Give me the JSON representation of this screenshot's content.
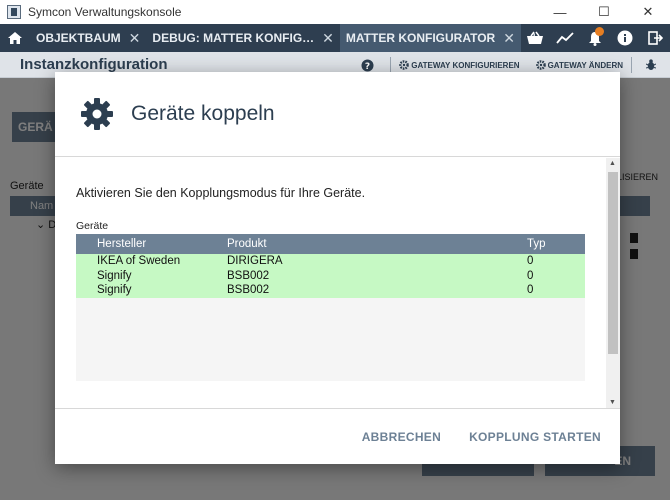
{
  "window": {
    "title": "Symcon Verwaltungskonsole",
    "minimize": "—",
    "maximize": "☐",
    "close": "✕"
  },
  "tabs": [
    {
      "label": "OBJEKTBAUM",
      "active": false
    },
    {
      "label": "DEBUG: MATTER KONFIG…",
      "active": false
    },
    {
      "label": "MATTER KONFIGURATOR",
      "active": true
    }
  ],
  "tab_close": "✕",
  "tab_add": "+",
  "toolbar": {
    "heading": "Instanzkonfiguration",
    "help": "?",
    "gateway_configure": "GATEWAY KONFIGURIEREN",
    "gateway_change": "GATEWAY ÄNDERN"
  },
  "background": {
    "devices_button": "GERÄ",
    "devices_label": "Geräte",
    "table_header": "Nam",
    "row_prefix": "⌄ D",
    "refresh": "ALISIEREN",
    "footer_btn": "EN"
  },
  "dialog": {
    "title": "Geräte koppeln",
    "intro": "Aktivieren Sie den Kopplungsmodus für Ihre Geräte.",
    "list_label": "Geräte",
    "columns": [
      "Hersteller",
      "Produkt",
      "Typ"
    ],
    "rows": [
      {
        "manufacturer": "IKEA of Sweden",
        "product": "DIRIGERA",
        "type": "0"
      },
      {
        "manufacturer": "Signify",
        "product": "BSB002",
        "type": "0"
      },
      {
        "manufacturer": "Signify",
        "product": "BSB002",
        "type": "0"
      }
    ],
    "cancel": "ABBRECHEN",
    "start": "KOPPLUNG STARTEN"
  },
  "colors": {
    "tabbar": "#2e3e50",
    "active_tab": "#455a70",
    "table_header": "#6d8195",
    "row_highlight": "#c6f9c4",
    "accent_text": "#6d8195"
  }
}
